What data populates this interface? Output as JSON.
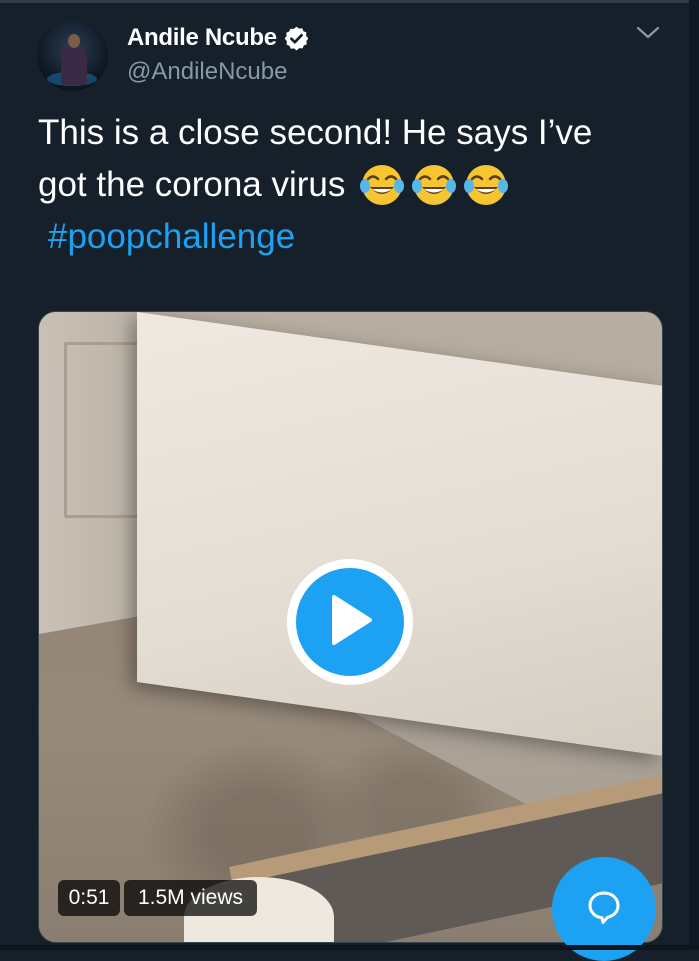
{
  "tweet": {
    "display_name": "Andile Ncube",
    "handle": "@AndileNcube",
    "verified": true,
    "text_line1": "This is a close second! He says I’ve",
    "text_line2": "got the corona virus",
    "emojis": [
      "face-with-tears-of-joy-icon",
      "face-with-tears-of-joy-icon",
      "face-with-tears-of-joy-icon"
    ],
    "hashtag": "#poopchallenge"
  },
  "video": {
    "duration": "0:51",
    "views": "1.5M views"
  },
  "icons": {
    "verified": "verified-badge-icon",
    "more": "chevron-down-icon",
    "play": "play-icon",
    "reply": "speech-bubble-icon"
  },
  "colors": {
    "background": "#15202b",
    "accent": "#1da1f2",
    "secondary_text": "#8899a6"
  }
}
